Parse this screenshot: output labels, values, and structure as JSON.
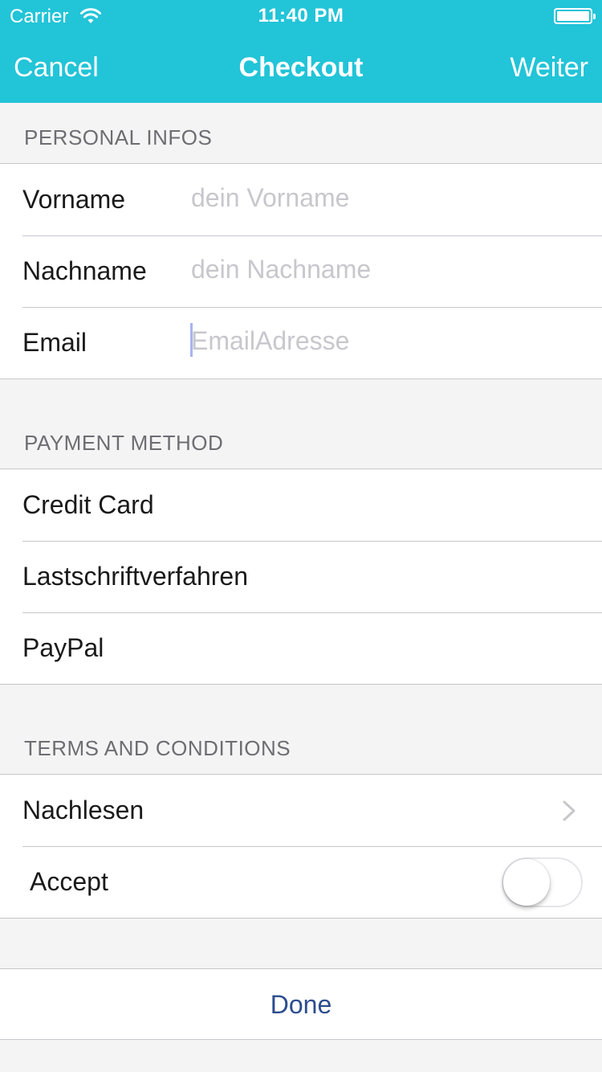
{
  "status_bar": {
    "carrier": "Carrier",
    "time": "11:40 PM",
    "wifi_icon": "wifi-icon",
    "battery_icon": "battery-icon"
  },
  "nav": {
    "left_label": "Cancel",
    "title": "Checkout",
    "right_label": "Weiter",
    "color": "#22c4d8"
  },
  "personal": {
    "header": "PERSONAL INFOS",
    "firstname_label": "Vorname",
    "firstname_placeholder": "dein Vorname",
    "lastname_label": "Nachname",
    "lastname_placeholder": "dein Nachname",
    "email_label": "Email",
    "email_placeholder": "EmailAdresse"
  },
  "payment": {
    "header": "PAYMENT METHOD",
    "options": [
      "Credit Card",
      "Lastschriftverfahren",
      "PayPal"
    ]
  },
  "terms": {
    "header": "TERMS AND CONDITIONS",
    "read_label": "Nachlesen",
    "read_icon": "chevron-right-icon",
    "accept_label": "Accept",
    "accept_on": false
  },
  "footer": {
    "done_label": "Done",
    "done_color": "#2d4d8e"
  }
}
